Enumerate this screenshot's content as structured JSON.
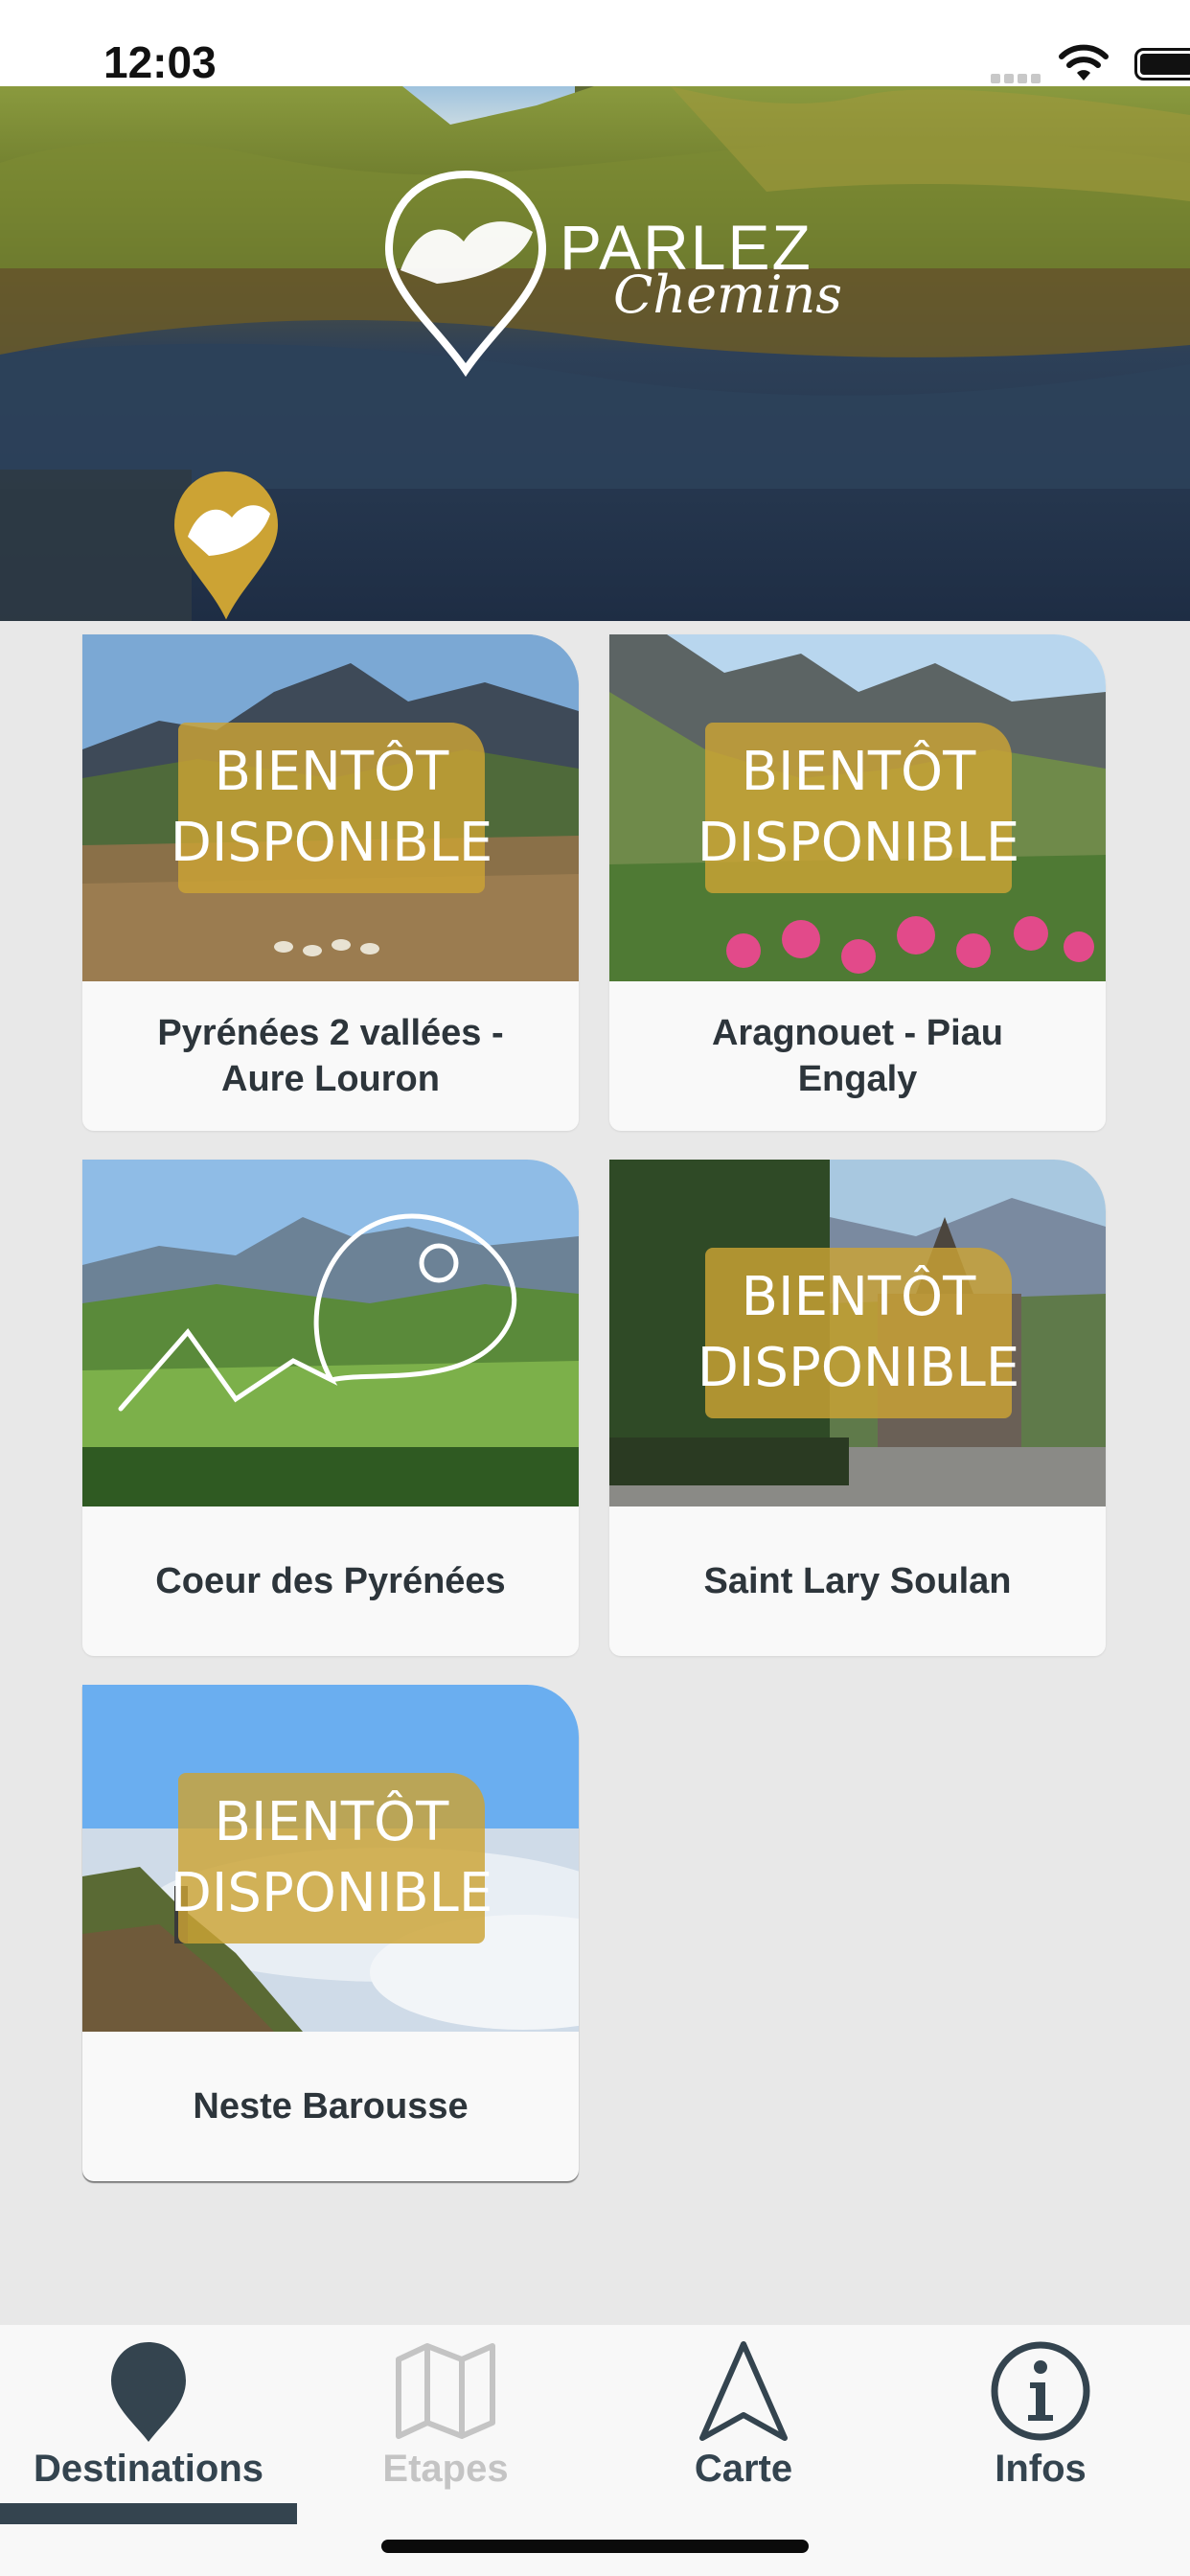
{
  "status_bar": {
    "time": "12:03"
  },
  "hero": {
    "brand_line1": "PARLEZ",
    "brand_line2": "Chemins"
  },
  "cards": [
    {
      "title": "Pyrénées 2 vallées - Aure Louron",
      "badge_line1": "BIENTÔT",
      "badge_line2": "DISPONIBLE",
      "coming_soon": true
    },
    {
      "title": "Aragnouet - Piau Engaly",
      "badge_line1": "BIENTÔT",
      "badge_line2": "DISPONIBLE",
      "coming_soon": true
    },
    {
      "title": "Coeur des Pyrénées",
      "coming_soon": false
    },
    {
      "title": "Saint Lary Soulan",
      "badge_line1": "BIENTÔT",
      "badge_line2": "DISPONIBLE",
      "coming_soon": true
    },
    {
      "title": "Neste Barousse",
      "badge_line1": "BIENTÔT",
      "badge_line2": "DISPONIBLE",
      "coming_soon": true
    }
  ],
  "tab_bar": {
    "tabs": [
      {
        "label": "Destinations",
        "icon": "map-pin-icon",
        "active": true
      },
      {
        "label": "Etapes",
        "icon": "map-icon",
        "active": false,
        "disabled": true
      },
      {
        "label": "Carte",
        "icon": "navigation-arrow-icon",
        "active": false
      },
      {
        "label": "Infos",
        "icon": "info-icon",
        "active": false
      }
    ]
  },
  "colors": {
    "accent_gold": "#cca334",
    "dark_slate": "#34444f",
    "background": "#e8e8e8",
    "card": "#f9f9f9",
    "disabled_text": "#c4c4c4"
  }
}
